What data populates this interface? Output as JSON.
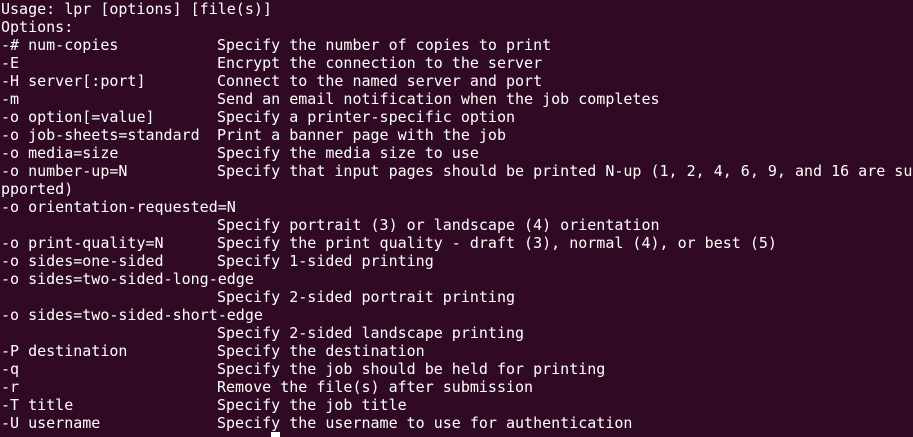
{
  "colors": {
    "background": "#300a24",
    "foreground": "#ffffff",
    "prompt_user": "#8ae234",
    "prompt_path": "#729fcf"
  },
  "terminal": {
    "usage": "Usage: lpr [options] [file(s)]",
    "options_header": "Options:",
    "rows": [
      {
        "option": "-# num-copies",
        "description": "Specify the number of copies to print"
      },
      {
        "option": "-E",
        "description": "Encrypt the connection to the server"
      },
      {
        "option": "-H server[:port]",
        "description": "Connect to the named server and port"
      },
      {
        "option": "-m",
        "description": "Send an email notification when the job completes"
      },
      {
        "option": "-o option[=value]",
        "description": "Specify a printer-specific option"
      },
      {
        "option": "-o job-sheets=standard",
        "description": "Print a banner page with the job"
      },
      {
        "option": "-o media=size",
        "description": "Specify the media size to use"
      },
      {
        "option": "-o number-up=N",
        "description": "Specify that input pages should be printed N-up (1, 2, 4, 6, 9, and 16 are su"
      },
      {
        "option": "",
        "description": "pported)",
        "full": true
      },
      {
        "option": "-o orientation-requested=N",
        "description": "",
        "full": true
      },
      {
        "option": "",
        "description": "Specify portrait (3) or landscape (4) orientation"
      },
      {
        "option": "-o print-quality=N",
        "description": "Specify the print quality - draft (3), normal (4), or best (5)"
      },
      {
        "option": "-o sides=one-sided",
        "description": "Specify 1-sided printing"
      },
      {
        "option": "-o sides=two-sided-long-edge",
        "description": "",
        "full": true
      },
      {
        "option": "",
        "description": "Specify 2-sided portrait printing"
      },
      {
        "option": "-o sides=two-sided-short-edge",
        "description": "",
        "full": true
      },
      {
        "option": "",
        "description": "Specify 2-sided landscape printing"
      },
      {
        "option": "-P destination",
        "description": "Specify the destination"
      },
      {
        "option": "-q",
        "description": "Specify the job should be held for printing"
      },
      {
        "option": "-r",
        "description": "Remove the file(s) after submission"
      },
      {
        "option": "-T title",
        "description": "Specify the job title"
      },
      {
        "option": "-U username",
        "description": "Specify the username to use for authentication"
      }
    ]
  }
}
